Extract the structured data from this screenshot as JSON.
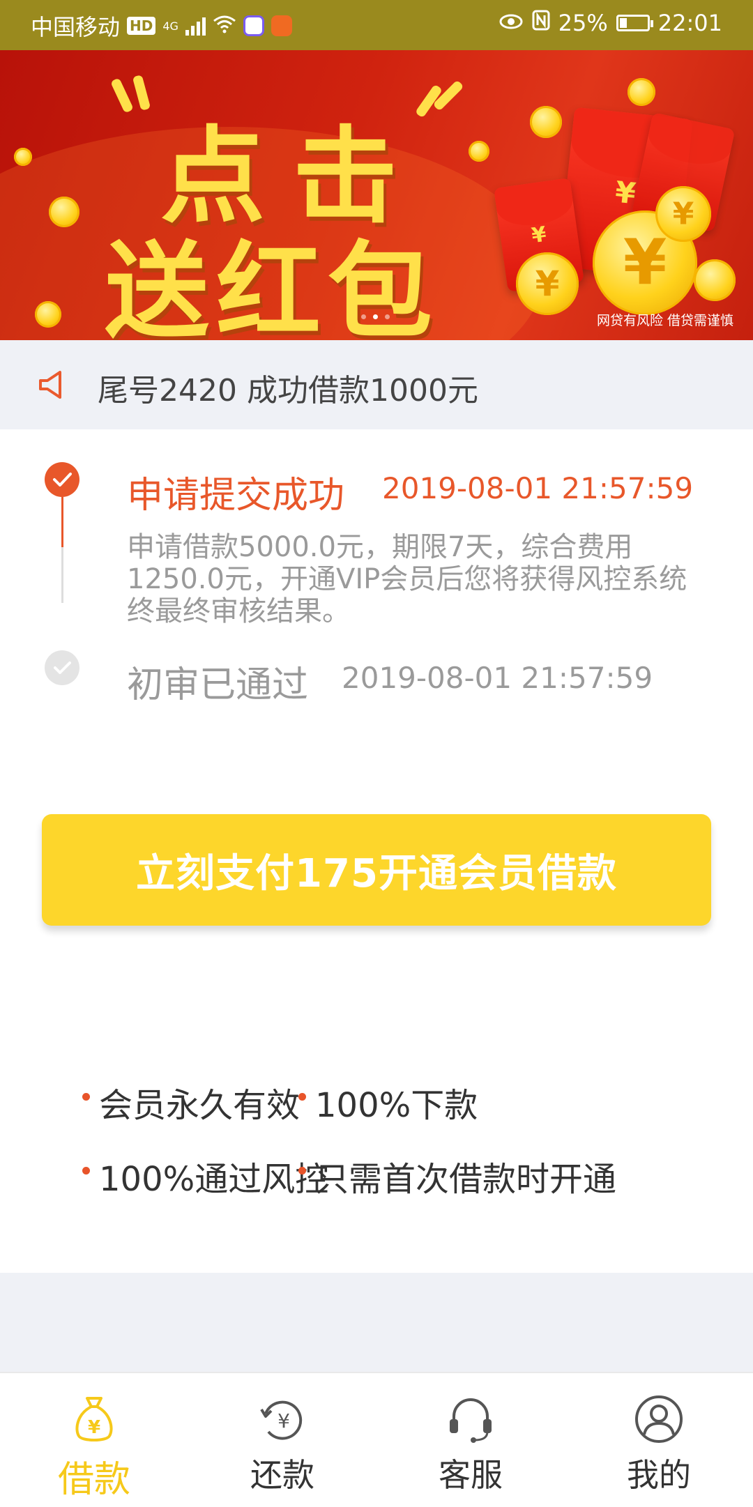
{
  "status_bar": {
    "carrier": "中国移动",
    "hd": "HD",
    "net": "4G",
    "battery": "25%",
    "time": "22:01"
  },
  "banner": {
    "line1": "点击",
    "line2": "送红包",
    "risk": "网贷有风险  借贷需谨慎",
    "coin_symbol": "¥",
    "active_dot": 2,
    "colors": {
      "bg": "#c5200e",
      "text": "#ffe04a"
    }
  },
  "notice": {
    "text": "尾号2420 成功借款1000元"
  },
  "timeline": [
    {
      "title": "申请提交成功",
      "time": "2019-08-01 21:57:59",
      "desc": "申请借款5000.0元，期限7天，综合费用1250.0元，开通VIP会员后您将获得风控系统终最终审核结果。",
      "state": "done",
      "color": "#e8572a"
    },
    {
      "title": "初审已通过",
      "time": "2019-08-01 21:57:59",
      "state": "pending",
      "color": "#dddddd"
    }
  ],
  "pay_button": {
    "label": "立刻支付175开通会员借款",
    "color": "#fdd62b"
  },
  "benefits": [
    "会员永久有效",
    "100%下款",
    "100%通过风控",
    "只需首次借款时开通"
  ],
  "tabs": [
    {
      "label": "借款",
      "icon": "money-bag-icon",
      "active": true
    },
    {
      "label": "还款",
      "icon": "repay-icon",
      "active": false
    },
    {
      "label": "客服",
      "icon": "headset-icon",
      "active": false
    },
    {
      "label": "我的",
      "icon": "user-icon",
      "active": false
    }
  ],
  "accent_color": "#f6c91a"
}
